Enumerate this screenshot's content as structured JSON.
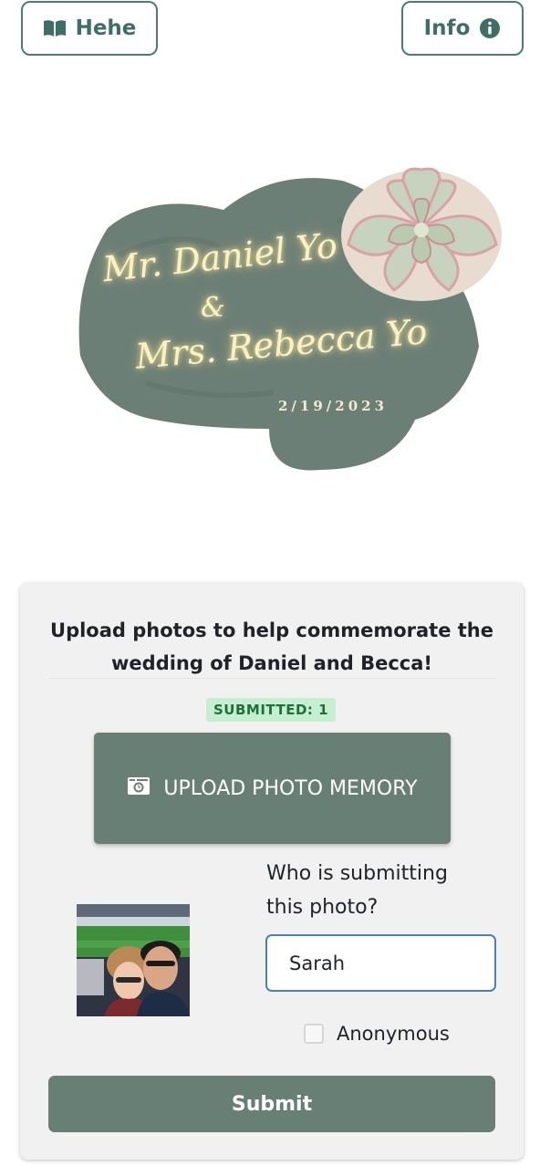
{
  "header": {
    "hehe_label": "Hehe",
    "info_label": "Info"
  },
  "logo": {
    "groom": "Mr. Daniel Yo",
    "ampersand": "&",
    "bride": "Mrs. Rebecca Yo",
    "date": "2/19/2023"
  },
  "upload_card": {
    "heading_line1": "Upload photos to help commemorate the",
    "heading_line2": "wedding of Daniel and Becca!",
    "submitted_badge": "SUBMITTED: 1",
    "upload_button_label": "UPLOAD PHOTO MEMORY",
    "who_label_line1": "Who is submitting",
    "who_label_line2": "this photo?",
    "name_value": "Sarah",
    "anonymous_label": "Anonymous",
    "anonymous_checked": false,
    "submit_label": "Submit"
  },
  "colors": {
    "accent": "#677f75",
    "outline": "#4f7a72",
    "badge_bg": "#c6efd1",
    "badge_text": "#1f6f3a",
    "input_focus": "#4a7fc0"
  },
  "icons": {
    "hehe": "book-open-icon",
    "info": "info-circle-icon",
    "upload": "camera-icon"
  }
}
